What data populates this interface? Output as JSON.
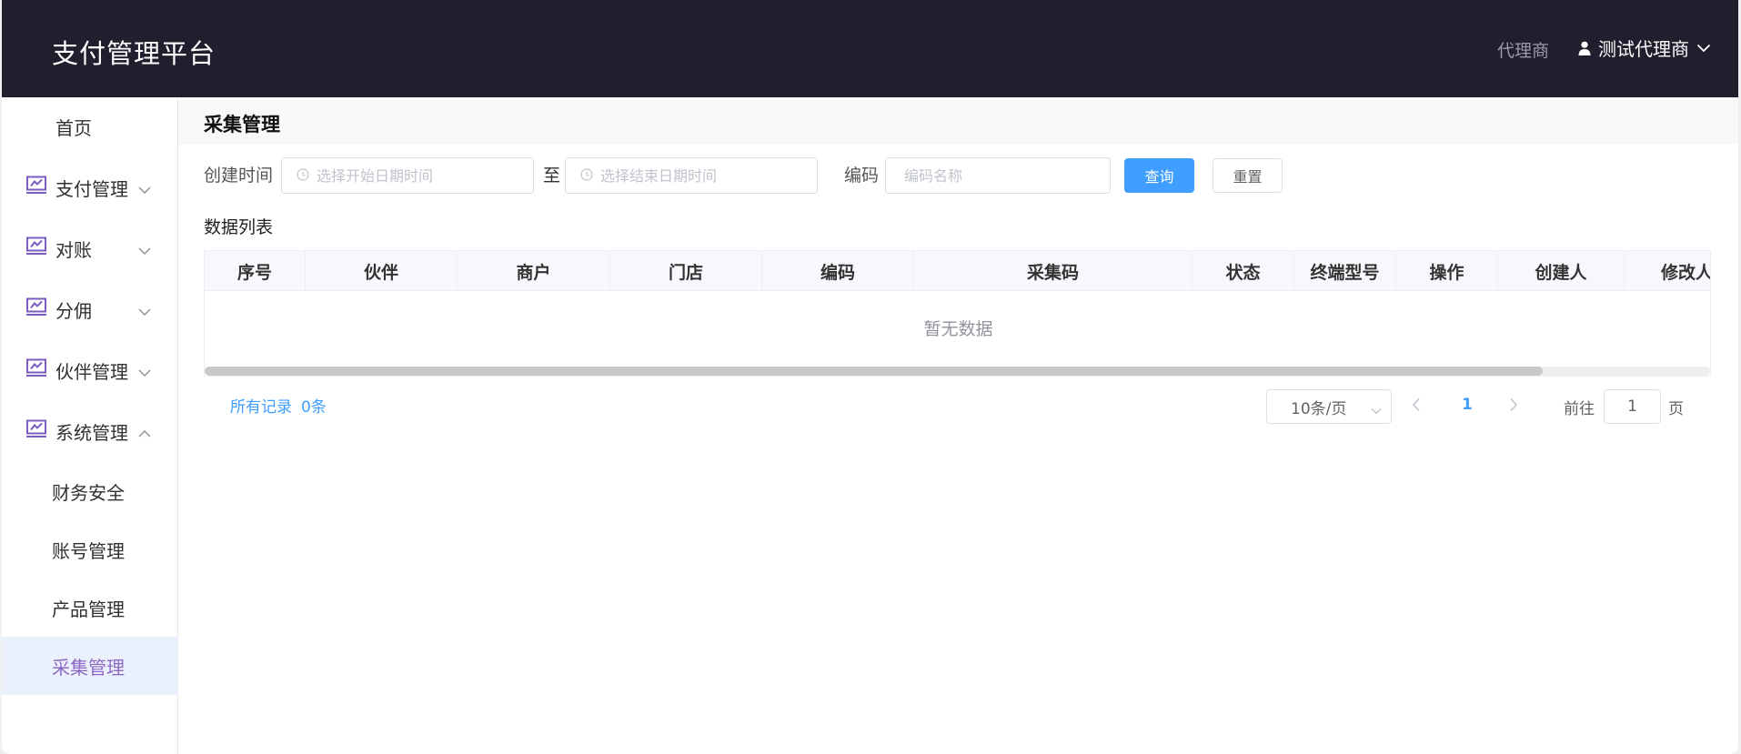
{
  "header": {
    "brand": "支付管理平台",
    "role": "代理商",
    "user_name": "测试代理商"
  },
  "sidebar": {
    "home": "首页",
    "items": [
      {
        "label": "支付管理",
        "icon": "chart-board-icon",
        "expanded": false
      },
      {
        "label": "对账",
        "icon": "chart-board-icon",
        "expanded": false
      },
      {
        "label": "分佣",
        "icon": "chart-board-icon",
        "expanded": false
      },
      {
        "label": "伙伴管理",
        "icon": "chart-board-icon",
        "expanded": false
      },
      {
        "label": "系统管理",
        "icon": "chart-board-icon",
        "expanded": true
      }
    ],
    "sub_items": [
      "财务安全",
      "账号管理",
      "产品管理",
      "采集管理"
    ],
    "active_sub_item": "采集管理"
  },
  "main": {
    "page_title": "采集管理",
    "filters": {
      "created_time_label": "创建时间",
      "start_placeholder": "选择开始日期时间",
      "range_separator": "至",
      "end_placeholder": "选择结束日期时间",
      "code_label": "编码",
      "code_placeholder": "编码名称",
      "query_button": "查询",
      "reset_button": "重置"
    },
    "list_title": "数据列表",
    "table": {
      "columns": [
        "序号",
        "伙伴",
        "商户",
        "门店",
        "编码",
        "采集码",
        "状态",
        "终端型号",
        "操作",
        "创建人",
        "修改人"
      ],
      "rows": [],
      "empty_text": "暂无数据"
    },
    "pagination": {
      "total_label": "所有记录",
      "total_count": "0条",
      "page_size": "10条/页",
      "current_page": "1",
      "goto_label": "前往",
      "goto_value": "1",
      "page_suffix": "页"
    }
  },
  "colors": {
    "header_bg": "#1f1f2d",
    "primary": "#409eff",
    "active_menu_bg": "#eaf1fc",
    "active_menu_text": "#8e68c4",
    "icon_purple": "#7b5cc2"
  }
}
